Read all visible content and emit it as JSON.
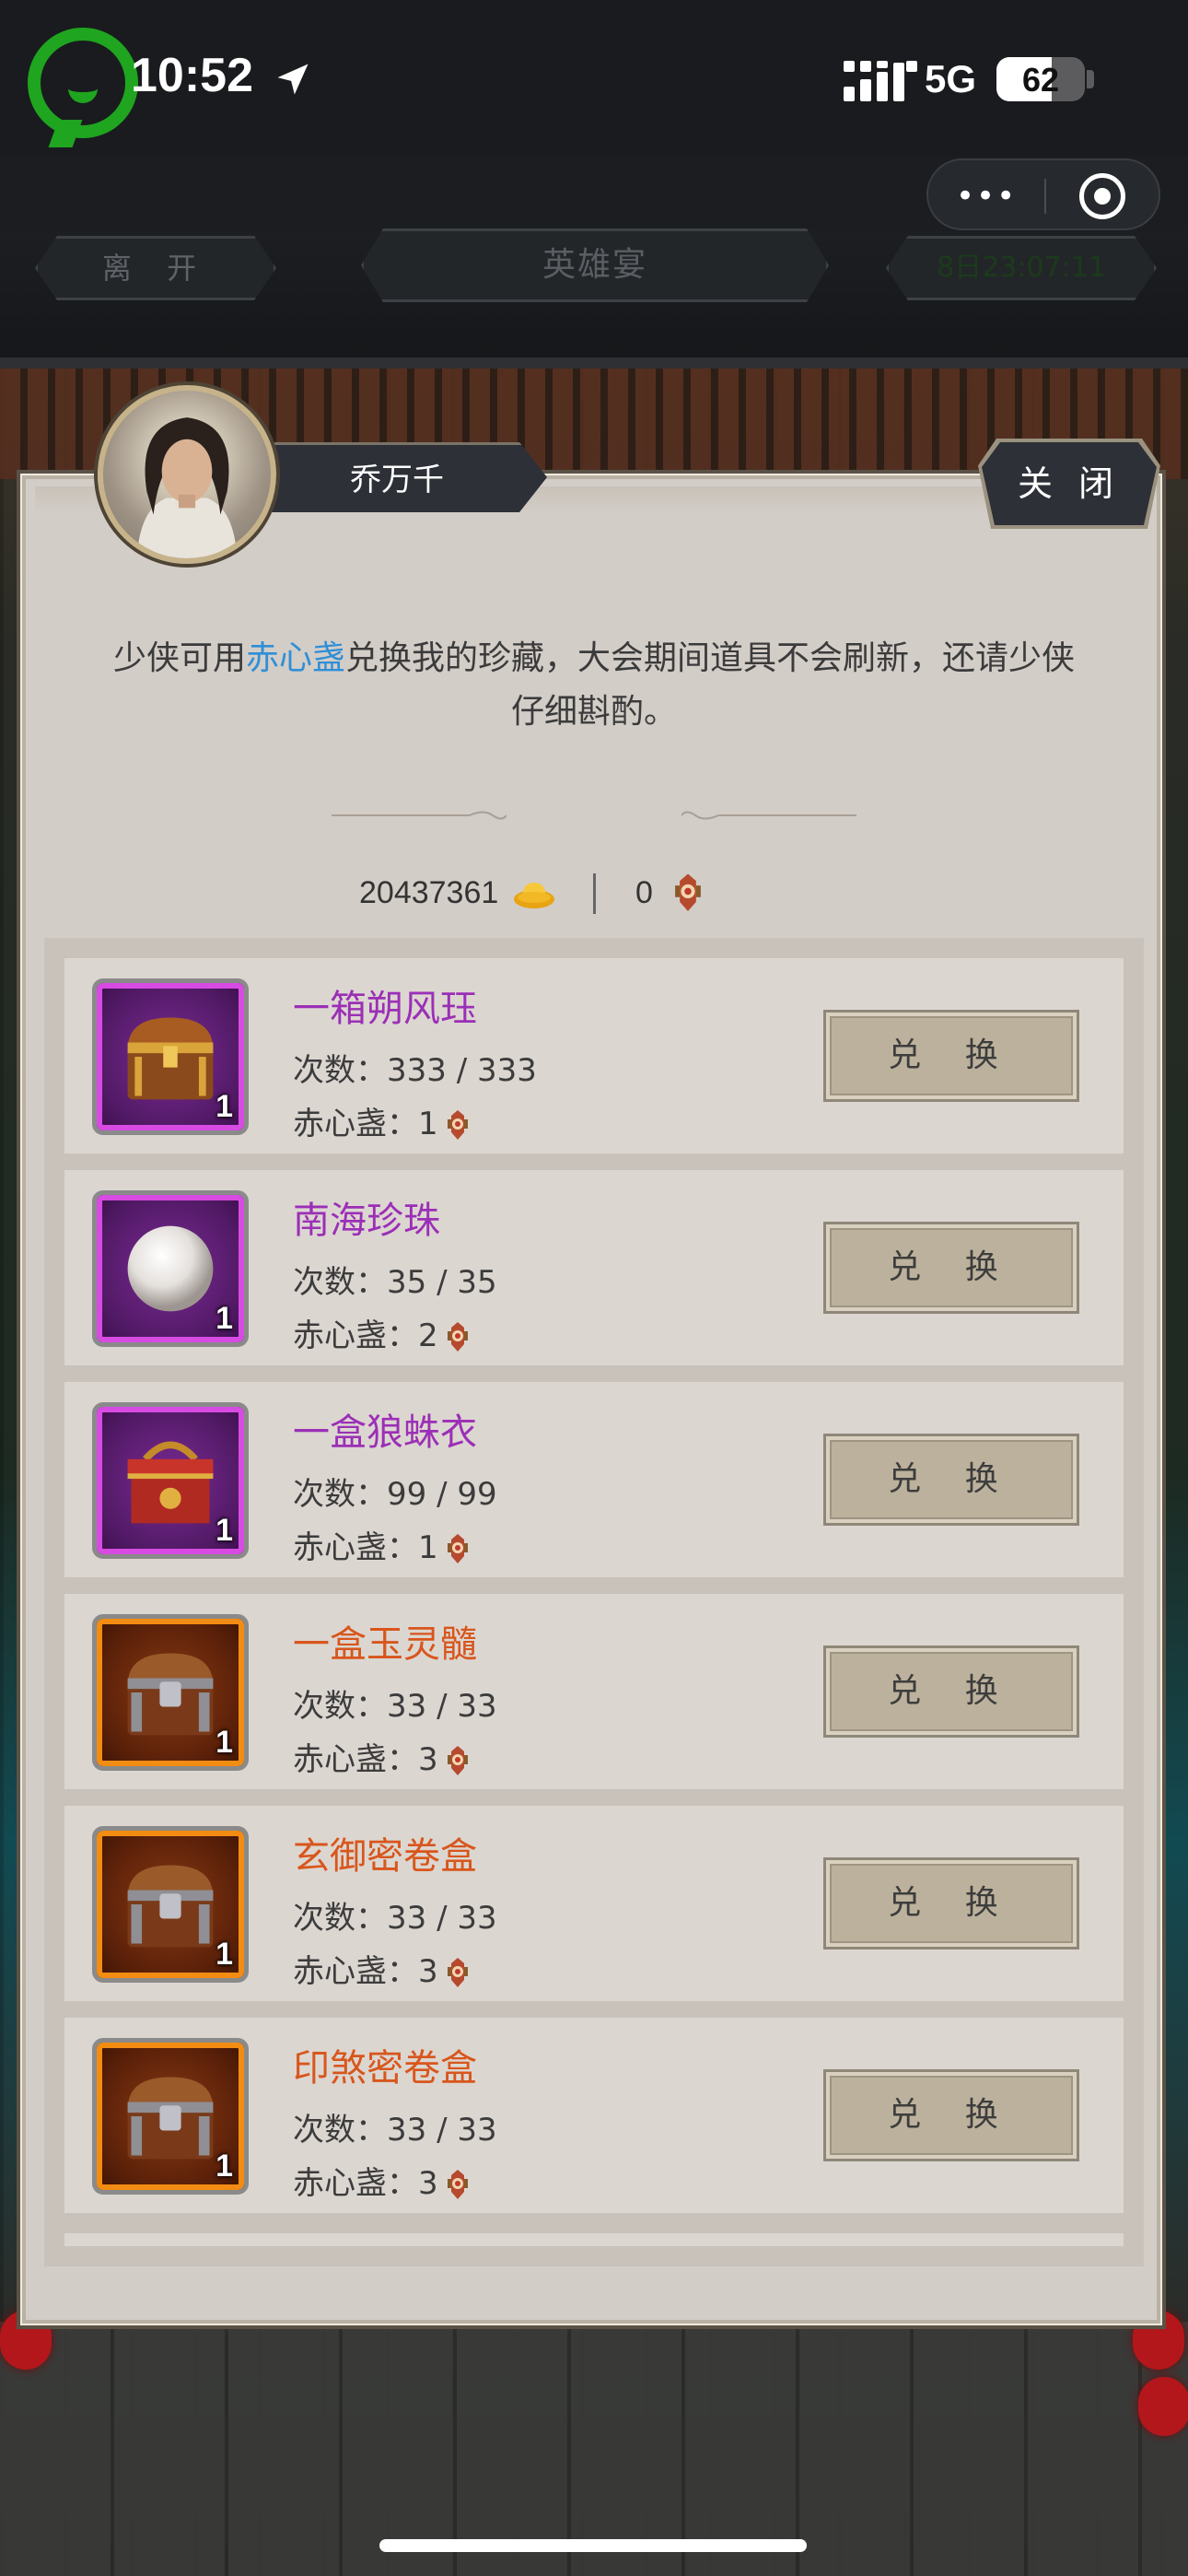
{
  "status_bar": {
    "time": "10:52",
    "network": "5G",
    "battery": "62",
    "icons": [
      "recording-indicator-icon",
      "location-arrow-icon",
      "cellular-signal-icon",
      "battery-icon"
    ]
  },
  "capsule": {
    "more": "•••",
    "icons": [
      "more-dots-icon",
      "close-target-icon"
    ]
  },
  "top_nav": {
    "leave": "离 开",
    "title": "英雄宴",
    "timer": "8日23:07:11"
  },
  "dialog": {
    "npc_name": "乔万千",
    "close": "关 闭",
    "intro_before": "少侠可用",
    "intro_highlight": "赤心盏",
    "intro_after": "兑换我的珍藏，大会期间道具不会刷新，还请少侠仔细斟酌。",
    "gold_amount": "20437361",
    "cup_amount": "0",
    "colors": {
      "highlight": "#2f8fd6",
      "purple_name": "#9b2fb6",
      "orange_name": "#d8561c"
    }
  },
  "items": [
    {
      "name": "一箱朔风珏",
      "rarity": "purple",
      "icon": "treasure-chest-icon",
      "qty": "1",
      "count_label": "次数：",
      "count": "333 / 333",
      "cost_label": "赤心盏：",
      "cost": "1",
      "button": "兑 换"
    },
    {
      "name": "南海珍珠",
      "rarity": "purple",
      "icon": "pearl-icon",
      "qty": "1",
      "count_label": "次数：",
      "count": "35 / 35",
      "cost_label": "赤心盏：",
      "cost": "2",
      "button": "兑 换"
    },
    {
      "name": "一盒狼蛛衣",
      "rarity": "purple",
      "icon": "red-box-icon",
      "qty": "1",
      "count_label": "次数：",
      "count": "99 / 99",
      "cost_label": "赤心盏：",
      "cost": "1",
      "button": "兑 换"
    },
    {
      "name": "一盒玉灵髓",
      "rarity": "orange",
      "icon": "iron-chest-icon",
      "qty": "1",
      "count_label": "次数：",
      "count": "33 / 33",
      "cost_label": "赤心盏：",
      "cost": "3",
      "button": "兑 换"
    },
    {
      "name": "玄御密卷盒",
      "rarity": "orange",
      "icon": "iron-chest-icon",
      "qty": "1",
      "count_label": "次数：",
      "count": "33 / 33",
      "cost_label": "赤心盏：",
      "cost": "3",
      "button": "兑 换"
    },
    {
      "name": "印煞密卷盒",
      "rarity": "orange",
      "icon": "iron-chest-icon",
      "qty": "1",
      "count_label": "次数：",
      "count": "33 / 33",
      "cost_label": "赤心盏：",
      "cost": "3",
      "button": "兑 换"
    }
  ]
}
